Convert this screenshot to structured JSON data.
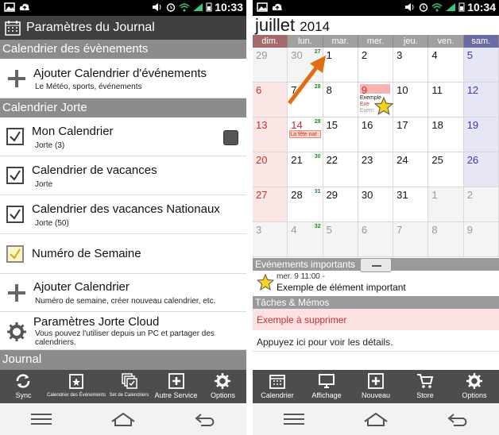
{
  "left": {
    "status": {
      "time": "10:33"
    },
    "header": {
      "title": "Paramètres du Journal"
    },
    "sections": {
      "events": "Calendrier des évènements",
      "jorte": "Calendrier Jorte",
      "journal": "Journal"
    },
    "items": [
      {
        "title": "Ajouter Calendrier d'événements",
        "sub": "Le Météo, sports, événements"
      },
      {
        "title": "Mon Calendrier",
        "sub": "Jorte (3)",
        "checked": true
      },
      {
        "title": "Calendrier de vacances",
        "sub": "Jorte",
        "checked": true
      },
      {
        "title": "Calendrier des vacances Nationaux",
        "sub": "Jorte (50)",
        "checked": true
      },
      {
        "title": "Numéro de Semaine",
        "checked": true
      },
      {
        "title": "Ajouter Calendrier",
        "sub": "Numéro de semaine, créer nouveau calendrier, etc."
      },
      {
        "title": "Paramètres Jorte Cloud",
        "sub": "Vous pouvez l'utiliser depuis un PC et partager des calendriers."
      }
    ],
    "toolbar": [
      "Sync",
      "Calendrier des Événements",
      "Set de Calendriers",
      "Autre Service",
      "Options"
    ]
  },
  "right": {
    "status": {
      "time": "10:34"
    },
    "month": "juillet",
    "year": "2014",
    "weekdays": [
      "dim.",
      "lun.",
      "mar.",
      "mer.",
      "jeu.",
      "ven.",
      "sam."
    ],
    "weeks": [
      {
        "wk": "27",
        "days": [
          "29",
          "30",
          "1",
          "2",
          "3",
          "4",
          "5"
        ]
      },
      {
        "wk": "28",
        "days": [
          "6",
          "7",
          "8",
          "9",
          "10",
          "11",
          "12"
        ]
      },
      {
        "wk": "29",
        "days": [
          "13",
          "14",
          "15",
          "16",
          "17",
          "18",
          "19"
        ]
      },
      {
        "wk": "30",
        "days": [
          "20",
          "21",
          "22",
          "23",
          "24",
          "25",
          "26"
        ]
      },
      {
        "wk": "31",
        "days": [
          "27",
          "28",
          "29",
          "30",
          "31",
          "1",
          "2"
        ]
      },
      {
        "wk": "32",
        "days": [
          "3",
          "4",
          "5",
          "6",
          "7",
          "8",
          "9"
        ]
      }
    ],
    "events": {
      "fete": "La fête nat",
      "ev1": "Exemple",
      "ev2": "Exe",
      "ev3": "Exem"
    },
    "important": {
      "label": "Evénements importants",
      "date": "mer. 9 11:00 -",
      "text": "Exemple de élément important"
    },
    "tasks": {
      "label": "Tâches & Mémos",
      "item": "Exemple à supprimer",
      "hint": "Appuyez ici pour voir les détails."
    },
    "toolbar": [
      "Calendrier",
      "Affichage",
      "Nouveau",
      "Store",
      "Options"
    ]
  },
  "colors": {
    "sunday": "#c13232",
    "saturday": "#3a3aa8",
    "weeknum": "#1c8d1c",
    "toolbar": "#4d4d4d"
  }
}
